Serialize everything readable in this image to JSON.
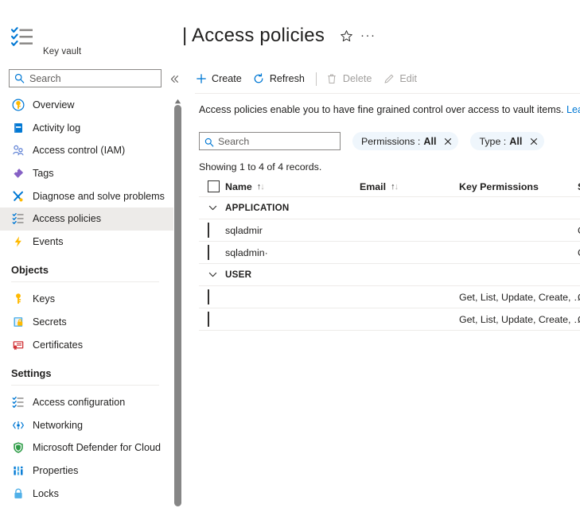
{
  "sidebar": {
    "resource_type": "Key vault",
    "resource_icon": "key-vault-checklist-icon",
    "search": {
      "placeholder": "Search",
      "icon": "search-icon"
    },
    "collapse_icon": "chevron-double-left-icon",
    "items": [
      {
        "label": "Overview",
        "icon": "overview-key-icon",
        "selected": false
      },
      {
        "label": "Activity log",
        "icon": "activity-log-icon",
        "selected": false
      },
      {
        "label": "Access control (IAM)",
        "icon": "access-control-people-icon",
        "selected": false
      },
      {
        "label": "Tags",
        "icon": "tags-icon",
        "selected": false
      },
      {
        "label": "Diagnose and solve problems",
        "icon": "diagnose-tools-icon",
        "selected": false
      },
      {
        "label": "Access policies",
        "icon": "access-policies-checklist-icon",
        "selected": true
      },
      {
        "label": "Events",
        "icon": "events-lightning-icon",
        "selected": false
      }
    ],
    "groups": [
      {
        "title": "Objects",
        "items": [
          {
            "label": "Keys",
            "icon": "key-icon"
          },
          {
            "label": "Secrets",
            "icon": "secret-lock-icon"
          },
          {
            "label": "Certificates",
            "icon": "certificate-icon"
          }
        ]
      },
      {
        "title": "Settings",
        "items": [
          {
            "label": "Access configuration",
            "icon": "access-configuration-checklist-icon"
          },
          {
            "label": "Networking",
            "icon": "networking-icon"
          },
          {
            "label": "Microsoft Defender for Cloud",
            "icon": "defender-shield-icon"
          },
          {
            "label": "Properties",
            "icon": "properties-bars-icon"
          },
          {
            "label": "Locks",
            "icon": "lock-icon"
          }
        ]
      }
    ]
  },
  "header": {
    "title_prefix": "|",
    "title": "Access policies",
    "favorite_icon": "star-icon",
    "more_icon": "ellipsis-icon"
  },
  "commandbar": {
    "items": [
      {
        "label": "Create",
        "icon": "plus-icon",
        "disabled": false
      },
      {
        "label": "Refresh",
        "icon": "refresh-icon",
        "disabled": false
      },
      {
        "label": "Delete",
        "icon": "trash-icon",
        "disabled": true
      },
      {
        "label": "Edit",
        "icon": "pencil-icon",
        "disabled": true
      }
    ]
  },
  "info": {
    "text": "Access policies enable you to have fine grained control over access to vault items. ",
    "link_label": "Learn more"
  },
  "filters": {
    "search": {
      "placeholder": "Search",
      "icon": "search-icon"
    },
    "pills": [
      {
        "key": "Permissions :",
        "value": "All",
        "clear_icon": "close-icon"
      },
      {
        "key": "Type :",
        "value": "All",
        "clear_icon": "close-icon"
      }
    ]
  },
  "table": {
    "record_summary": "Showing 1 to 4 of 4 records.",
    "select_all_checkbox": "unchecked",
    "columns": [
      {
        "label": "Name",
        "sortable": true
      },
      {
        "label": "Email",
        "sortable": true
      },
      {
        "label": "Key Permissions",
        "sortable": false
      },
      {
        "label": "S",
        "sortable": false
      }
    ],
    "groups": [
      {
        "name": "APPLICATION",
        "expanded": true,
        "chevron_icon": "chevron-down-icon",
        "rows": [
          {
            "name": "sqladmir",
            "email": "",
            "key_permissions": "",
            "secret_permissions": "G"
          },
          {
            "name": "sqladmin·",
            "email": "",
            "key_permissions": "",
            "secret_permissions": "G"
          }
        ]
      },
      {
        "name": "USER",
        "expanded": true,
        "chevron_icon": "chevron-down-icon",
        "rows": [
          {
            "name": "",
            "email": "",
            "key_permissions": "Get, List, Update, Create, …",
            "secret_permissions": "G"
          },
          {
            "name": "",
            "email": "",
            "key_permissions": "Get, List, Update, Create, …",
            "secret_permissions": "G"
          }
        ]
      }
    ]
  },
  "scrollbar": {
    "up_arrow_icon": "scroll-up-arrow-icon",
    "thumb": "vertical-scroll-thumb"
  },
  "colors": {
    "accent": "#0078d4",
    "selected_row": "#edebe9",
    "pill_bg": "#eff6fc",
    "disabled_text": "#a19f9d",
    "border": "#edebe9"
  }
}
